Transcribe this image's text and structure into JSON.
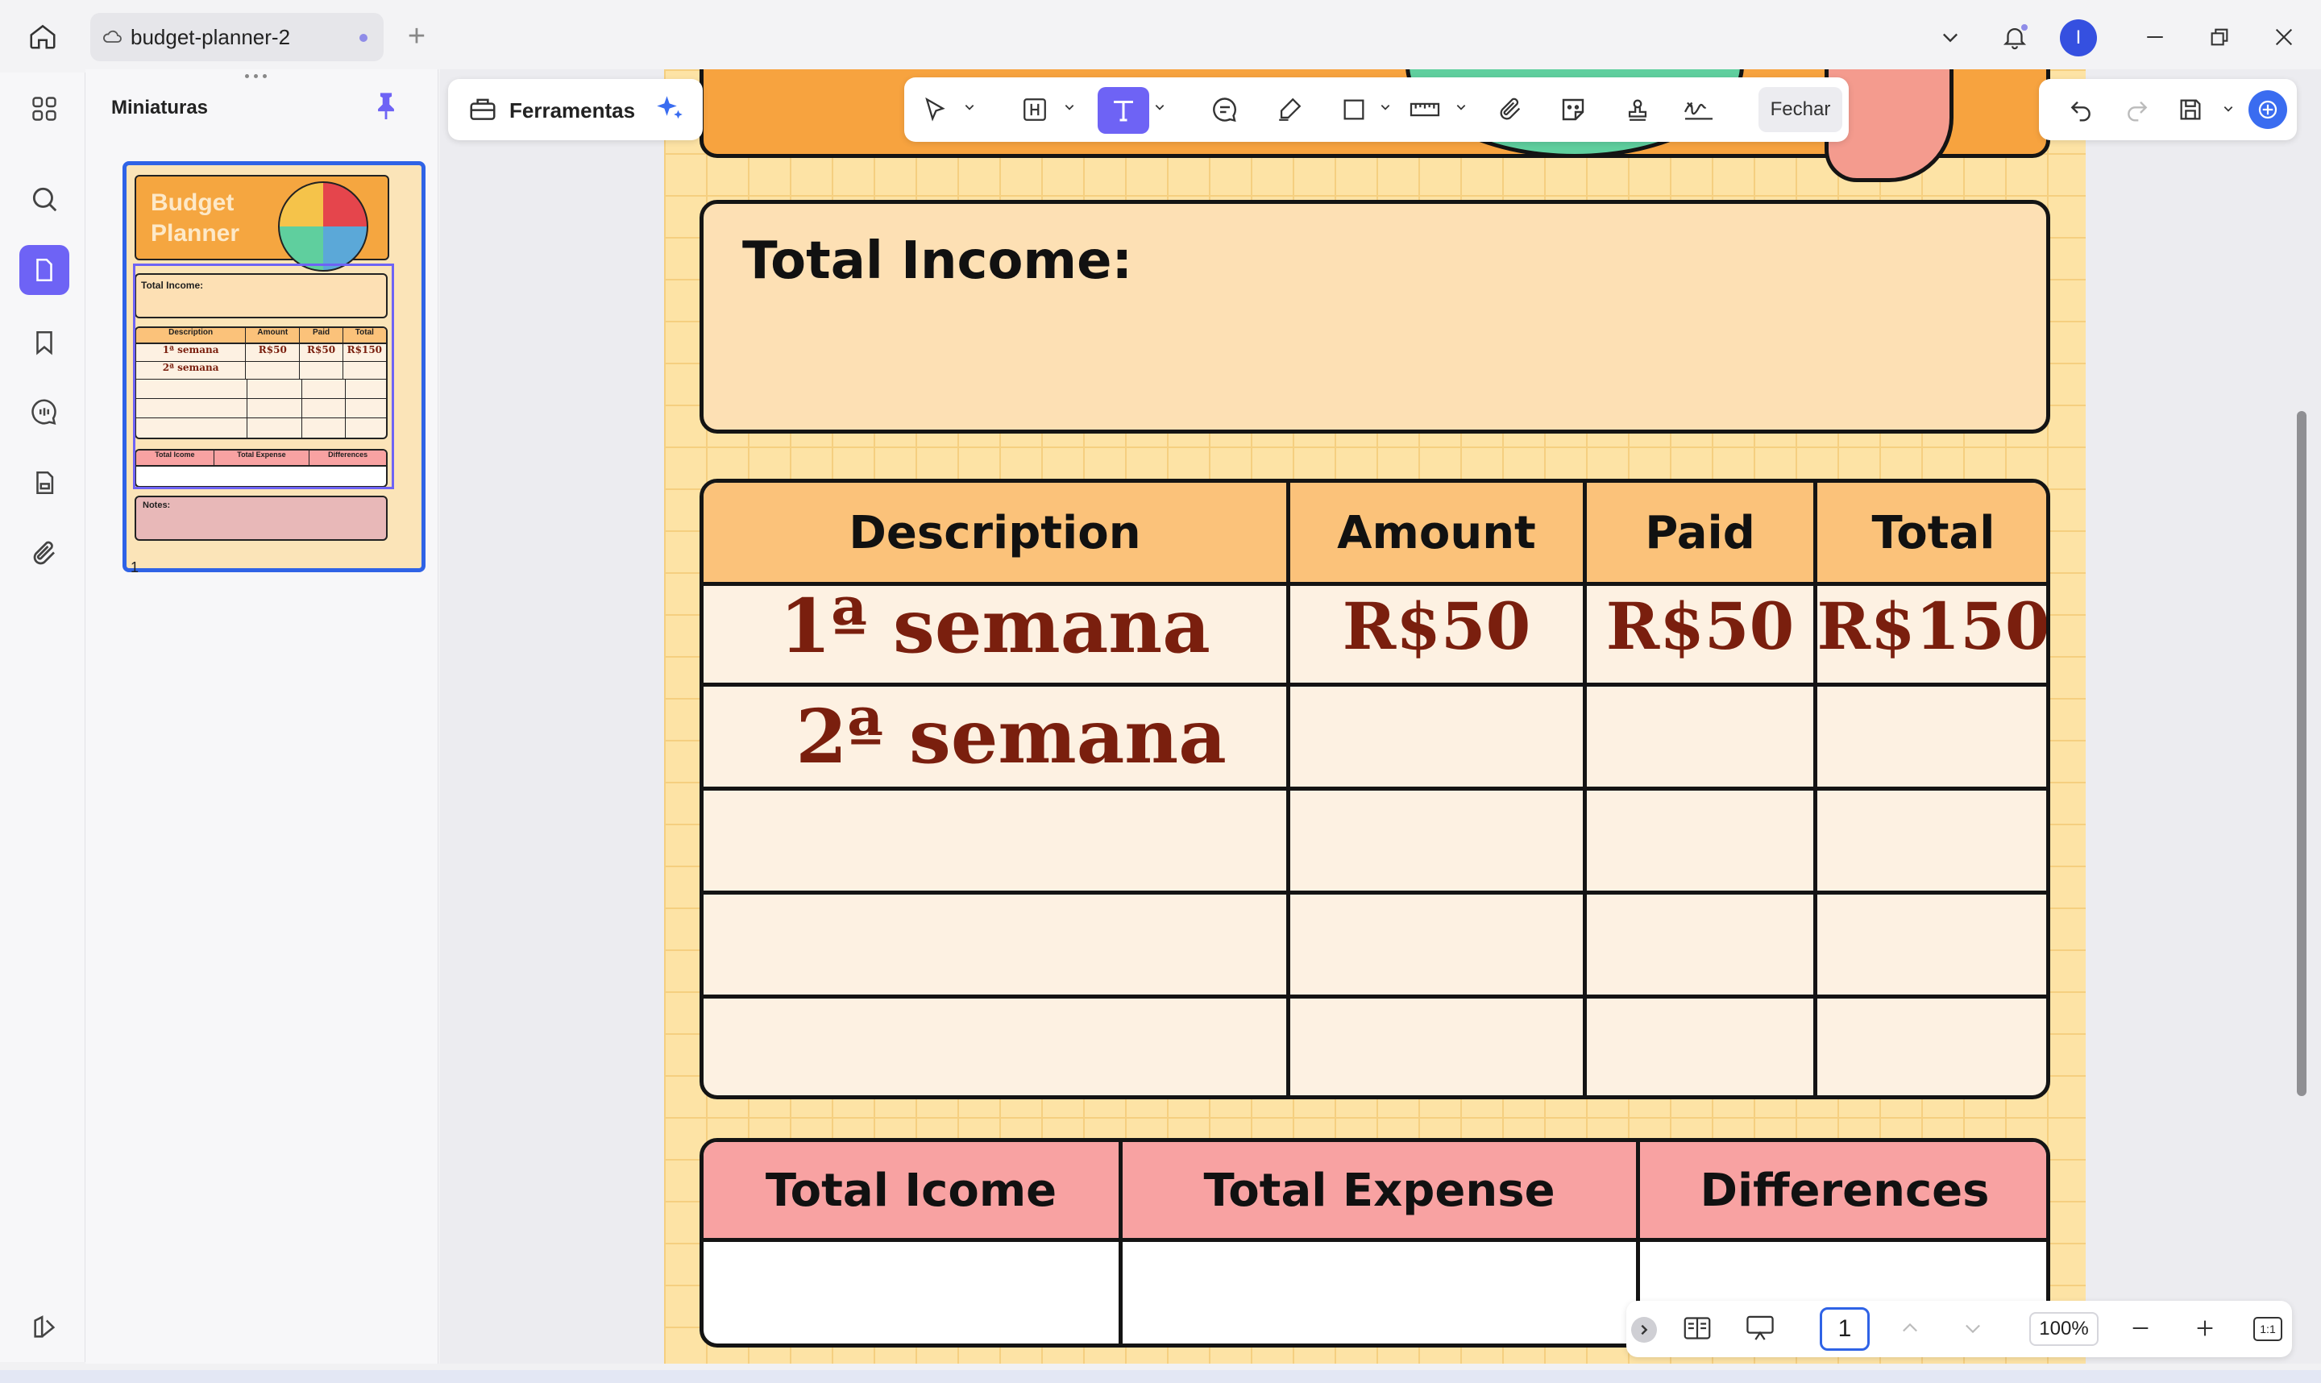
{
  "titlebar": {
    "tab_title": "budget-planner-2",
    "new_tab": "+",
    "avatar_letter": "I"
  },
  "thumbnails": {
    "title": "Miniaturas",
    "page_number": "1",
    "mini": {
      "title_line1": "Budget",
      "title_line2": "Planner",
      "total_income": "Total Income:",
      "headers": [
        "Description",
        "Amount",
        "Paid",
        "Total"
      ],
      "row1": [
        "1ª semana",
        "R$50",
        "R$50",
        "R$150"
      ],
      "row2": "2ª semana",
      "bottom_headers": [
        "Total Icome",
        "Total Expense",
        "Differences"
      ],
      "notes": "Notes:"
    }
  },
  "toolbar": {
    "tools_label": "Ferramentas",
    "close_label": "Fechar"
  },
  "document": {
    "total_income_label": "Total Income:",
    "table_headers": [
      "Description",
      "Amount",
      "Paid",
      "Total"
    ],
    "rows": [
      [
        "1ª semana",
        "R$50",
        "R$50",
        "R$150"
      ],
      [
        "2ª semana",
        "",
        "",
        ""
      ],
      [
        "",
        "",
        "",
        ""
      ],
      [
        "",
        "",
        "",
        ""
      ],
      [
        "",
        "",
        "",
        ""
      ]
    ],
    "summary_headers": [
      "Total Icome",
      "Total Expense",
      "Differences"
    ]
  },
  "statusbar": {
    "page_value": "1",
    "zoom": "100%",
    "fit_label": "1:1"
  },
  "colors": {
    "accent": "#6e63f5",
    "selection": "#2f63e6",
    "page_bg": "#fde3a5",
    "header_orange": "#fbc27a",
    "row_bg": "#fdf1e2",
    "income_box": "#fde0b4",
    "summary_pink": "#f8a2a2",
    "script_text": "#7a1f0e"
  }
}
